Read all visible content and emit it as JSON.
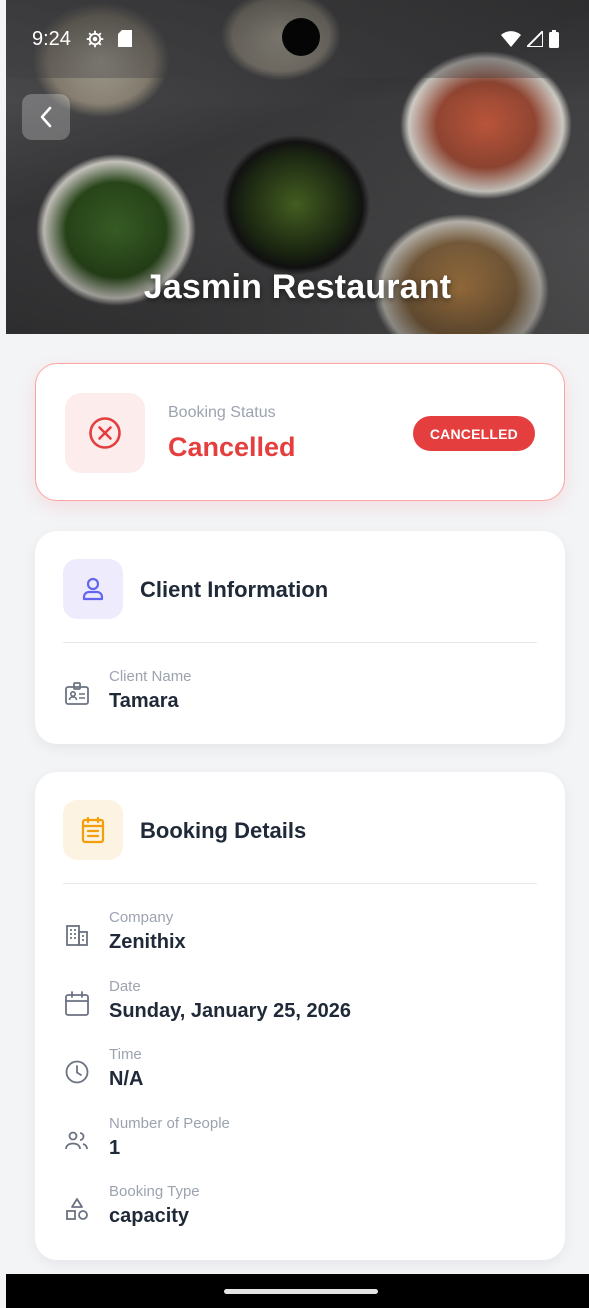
{
  "status_bar": {
    "time": "9:24"
  },
  "header": {
    "title": "Jasmin Restaurant"
  },
  "booking_status": {
    "label": "Booking Status",
    "value": "Cancelled",
    "badge": "CANCELLED",
    "color": "#e53e3e"
  },
  "client_section": {
    "title": "Client Information",
    "rows": [
      {
        "icon": "id-card-icon",
        "label": "Client Name",
        "value": "Tamara"
      }
    ]
  },
  "booking_section": {
    "title": "Booking Details",
    "rows": [
      {
        "icon": "building-icon",
        "label": "Company",
        "value": "Zenithix"
      },
      {
        "icon": "calendar-icon",
        "label": "Date",
        "value": "Sunday, January 25, 2026"
      },
      {
        "icon": "clock-icon",
        "label": "Time",
        "value": "N/A"
      },
      {
        "icon": "people-icon",
        "label": "Number of People",
        "value": "1"
      },
      {
        "icon": "shapes-icon",
        "label": "Booking Type",
        "value": "capacity"
      }
    ]
  }
}
